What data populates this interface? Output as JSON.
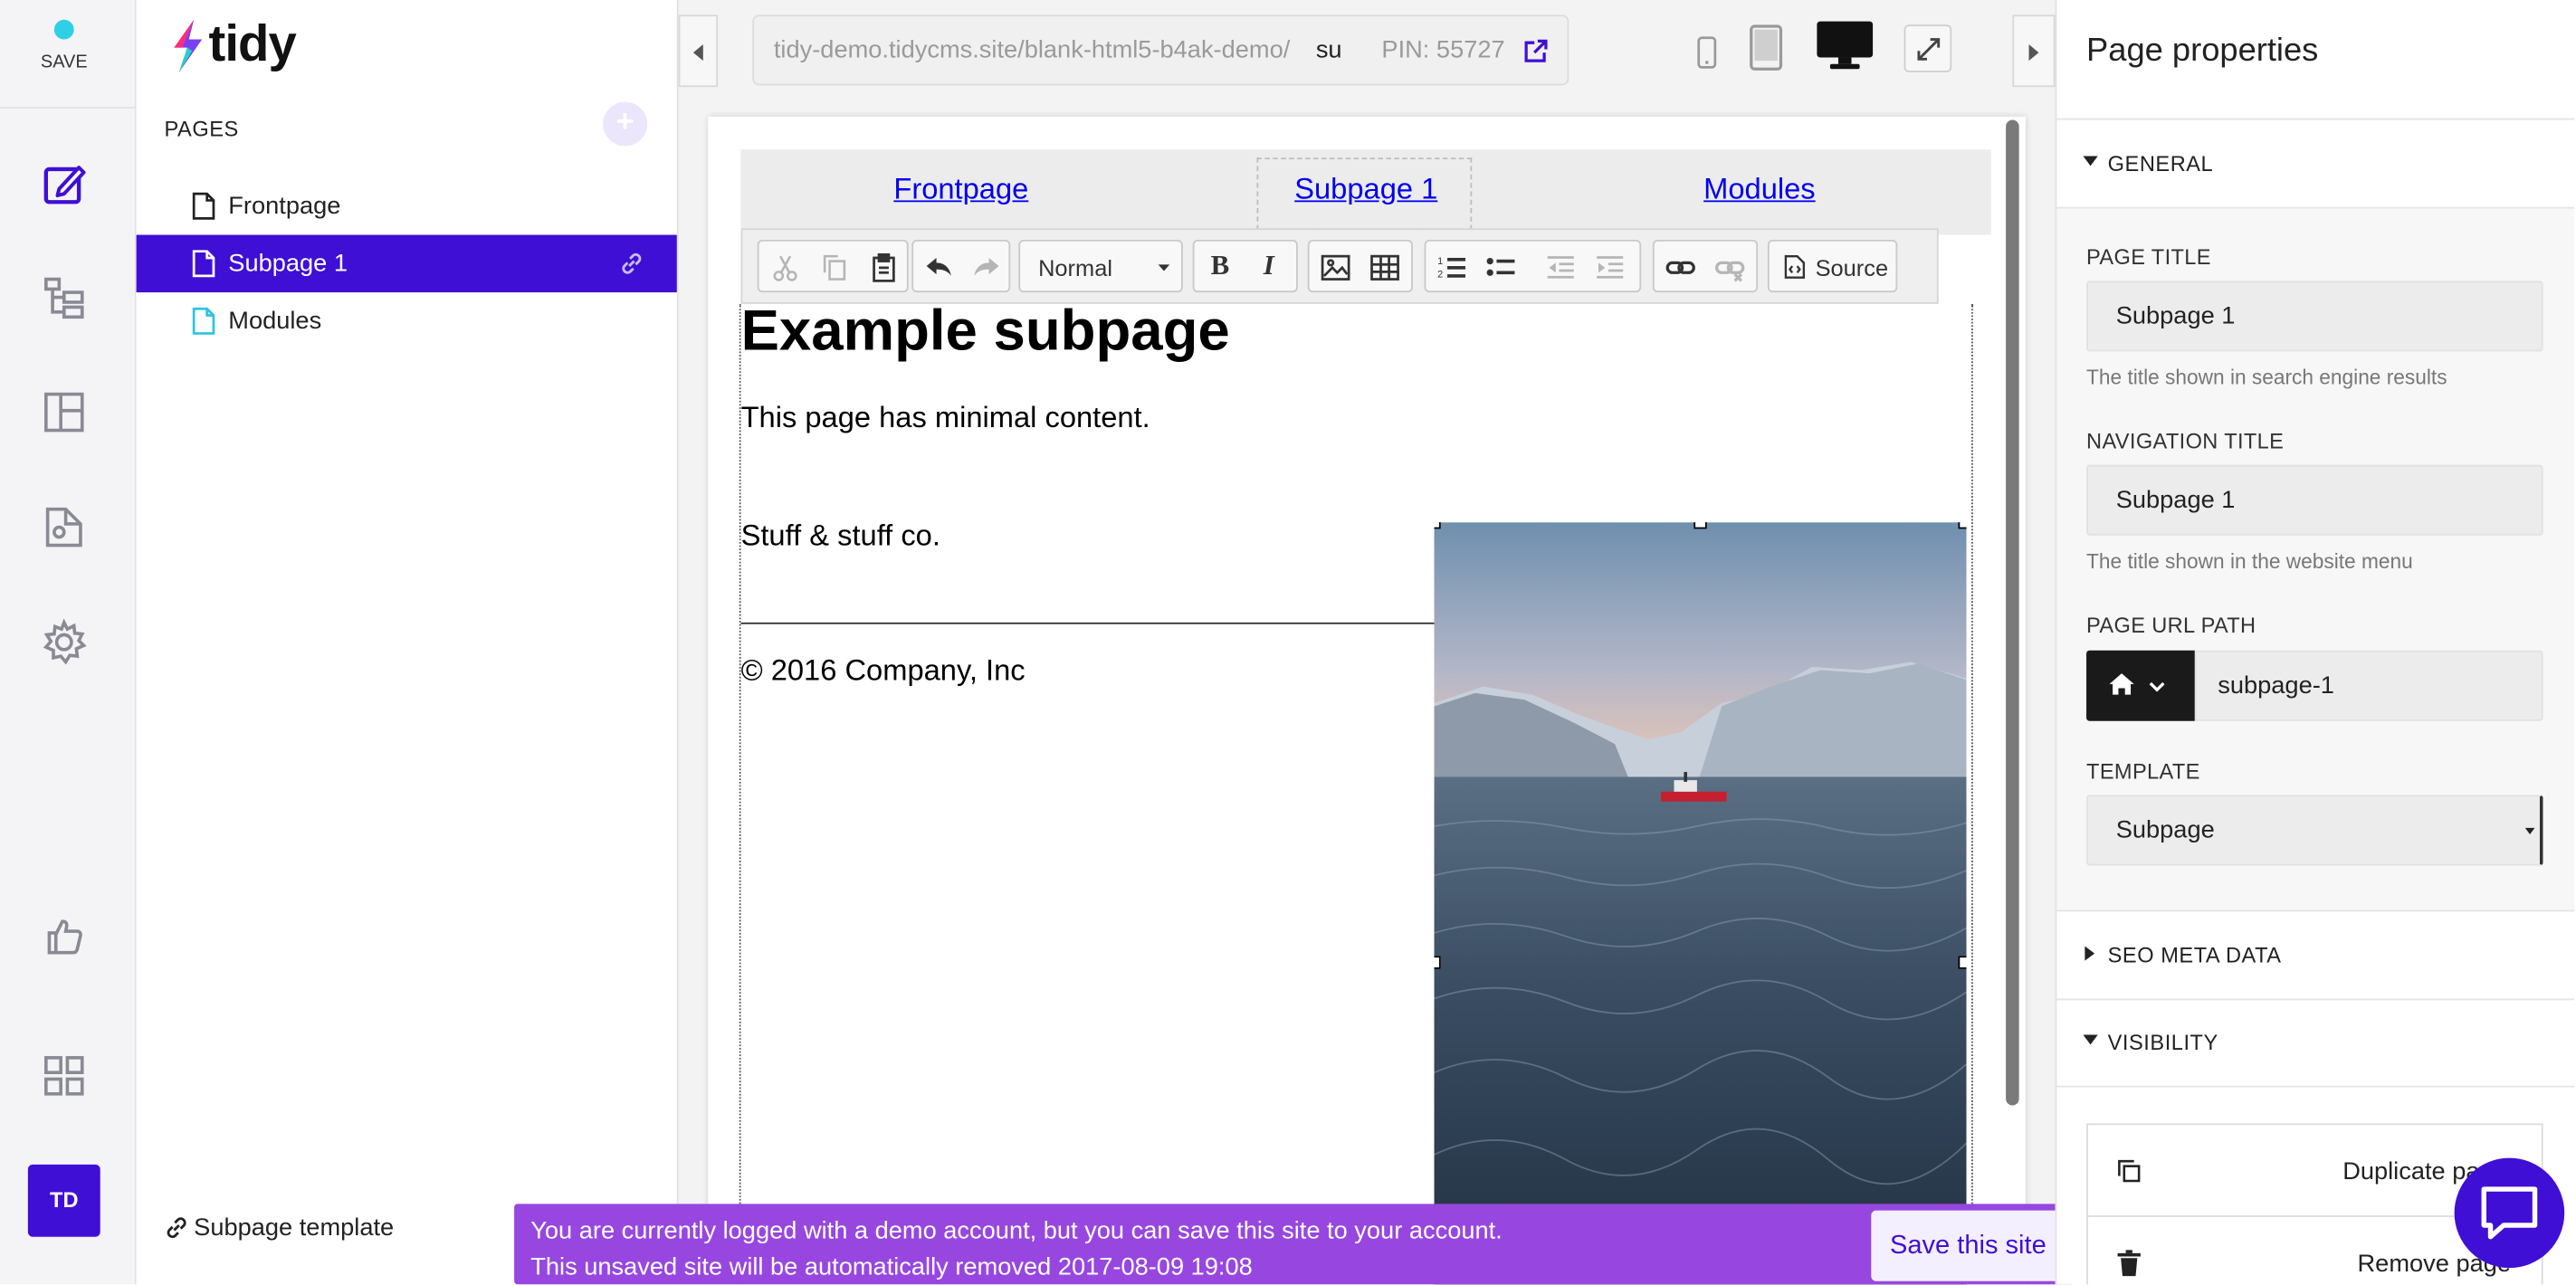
{
  "rail": {
    "save_label": "SAVE",
    "avatar": "TD",
    "colors": {
      "dot": "#2fd0e6",
      "avatar_bg": "#3f0fd6",
      "icon": "#8a8a96",
      "active_icon": "#3f0fd6"
    }
  },
  "brand": {
    "name": "tidy"
  },
  "pages_panel": {
    "heading": "PAGES",
    "items": [
      {
        "label": "Frontpage",
        "icon": "document-icon"
      },
      {
        "label": "Subpage 1",
        "icon": "document-icon",
        "active": true
      },
      {
        "label": "Modules",
        "icon": "document-icon"
      }
    ],
    "template_link": "Subpage template"
  },
  "topbar": {
    "url": "tidy-demo.tidycms.site/blank-html5-b4ak-demo/",
    "url_suffix": "su",
    "pin": "PIN: 55727"
  },
  "preview": {
    "nav": [
      "Frontpage",
      "Subpage 1",
      "Modules"
    ],
    "editor_toolbar": {
      "format": "Normal",
      "source_label": "Source"
    },
    "heading": "Example subpage",
    "body_text": "This page has minimal content.",
    "company": "Stuff & stuff co.",
    "footer": "© 2016 Company, Inc"
  },
  "properties": {
    "title": "Page properties",
    "general_label": "GENERAL",
    "page_title_label": "PAGE TITLE",
    "page_title_value": "Subpage 1",
    "page_title_hint": "The title shown in search engine results",
    "nav_title_label": "NAVIGATION TITLE",
    "nav_title_value": "Subpage 1",
    "nav_title_hint": "The title shown in the website menu",
    "url_path_label": "PAGE URL PATH",
    "url_path_value": "subpage-1",
    "template_label": "TEMPLATE",
    "template_value": "Subpage",
    "seo_label": "SEO META DATA",
    "visibility_label": "VISIBILITY",
    "duplicate_label": "Duplicate pa",
    "remove_label": "Remove page"
  },
  "banner": {
    "line1": "You are currently logged with a demo account, but you can save this site to your account.",
    "line2": "This unsaved site will be automatically removed 2017-08-09 19:08",
    "button": "Save this site",
    "color": "#9747e0"
  }
}
